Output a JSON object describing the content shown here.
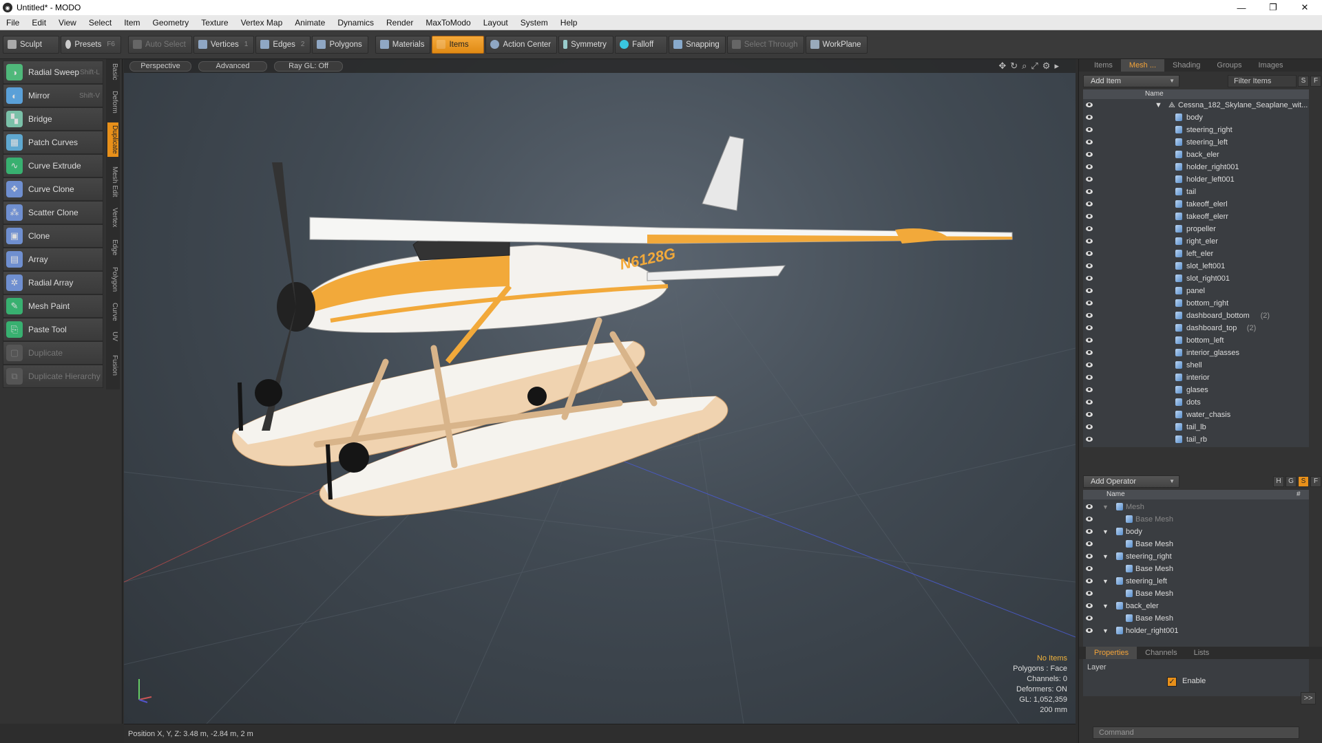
{
  "window": {
    "title": "Untitled* - MODO",
    "minimize": "—",
    "restore": "❐",
    "close": "✕"
  },
  "menu": [
    "File",
    "Edit",
    "View",
    "Select",
    "Item",
    "Geometry",
    "Texture",
    "Vertex Map",
    "Animate",
    "Dynamics",
    "Render",
    "MaxToModo",
    "Layout",
    "System",
    "Help"
  ],
  "toolbar": {
    "sculpt": "Sculpt",
    "presets": "Presets",
    "presets_key": "F6",
    "auto_select": "Auto Select",
    "vertices": "Vertices",
    "vertices_key": "1",
    "edges": "Edges",
    "edges_key": "2",
    "polygons": "Polygons",
    "materials": "Materials",
    "items": "Items",
    "action_center": "Action Center",
    "symmetry": "Symmetry",
    "falloff": "Falloff",
    "snapping": "Snapping",
    "select_through": "Select Through",
    "workplane": "WorkPlane"
  },
  "tools": [
    {
      "label": "Radial Sweep",
      "key": "Shift-L",
      "color": "#4fb87a"
    },
    {
      "label": "Mirror",
      "key": "Shift-V",
      "color": "#5aa0d8"
    },
    {
      "label": "Bridge",
      "key": "",
      "color": "#7ac0a8"
    },
    {
      "label": "Patch Curves",
      "key": "",
      "color": "#5fa8d0"
    },
    {
      "label": "Curve Extrude",
      "key": "",
      "color": "#38b070"
    },
    {
      "label": "Curve Clone",
      "key": "",
      "color": "#6f8fd0"
    },
    {
      "label": "Scatter Clone",
      "key": "",
      "color": "#6f8fd0"
    },
    {
      "label": "Clone",
      "key": "",
      "color": "#6f8fd0"
    },
    {
      "label": "Array",
      "key": "",
      "color": "#6f8fd0"
    },
    {
      "label": "Radial Array",
      "key": "",
      "color": "#6f8fd0"
    },
    {
      "label": "Mesh Paint",
      "key": "",
      "color": "#38b070"
    },
    {
      "label": "Paste Tool",
      "key": "",
      "color": "#38b070"
    },
    {
      "label": "Duplicate",
      "key": "",
      "color": "#666"
    },
    {
      "label": "Duplicate Hierarchy",
      "key": "",
      "color": "#666"
    }
  ],
  "vtabs": [
    "Basic",
    "Deform",
    "Duplicate",
    "Mesh Edit",
    "Vertex",
    "Edge",
    "Polygon",
    "Curve",
    "UV",
    "Fusion"
  ],
  "viewport": {
    "perspective": "Perspective",
    "advanced": "Advanced",
    "raygl": "Ray GL: Off",
    "info": {
      "no_items": "No Items",
      "polygons": "Polygons : Face",
      "channels": "Channels: 0",
      "deformers": "Deformers: ON",
      "gl": "GL: 1,052,359",
      "scale": "200 mm"
    },
    "registration": "N6128G"
  },
  "status": {
    "position": "Position X, Y, Z:  3.48 m, -2.84 m, 2 m"
  },
  "right": {
    "tabs": [
      "Items",
      "Mesh ...",
      "Shading",
      "Groups",
      "Images"
    ],
    "add_item": "Add Item",
    "filter_items": "Filter Items",
    "s_btn": "S",
    "f_btn": "F",
    "name_col": "Name",
    "root": "Cessna_182_Skylane_Seaplane_wit...",
    "items": [
      {
        "label": "body",
        "count": ""
      },
      {
        "label": "steering_right",
        "count": ""
      },
      {
        "label": "steering_left",
        "count": ""
      },
      {
        "label": "back_eler",
        "count": ""
      },
      {
        "label": "holder_right001",
        "count": ""
      },
      {
        "label": "holder_left001",
        "count": ""
      },
      {
        "label": "tail",
        "count": ""
      },
      {
        "label": "takeoff_elerl",
        "count": ""
      },
      {
        "label": "takeoff_elerr",
        "count": ""
      },
      {
        "label": "propeller",
        "count": ""
      },
      {
        "label": "right_eler",
        "count": ""
      },
      {
        "label": "left_eler",
        "count": ""
      },
      {
        "label": "slot_left001",
        "count": ""
      },
      {
        "label": "slot_right001",
        "count": ""
      },
      {
        "label": "panel",
        "count": ""
      },
      {
        "label": "bottom_right",
        "count": ""
      },
      {
        "label": "dashboard_bottom",
        "count": "(2)"
      },
      {
        "label": "dashboard_top",
        "count": "(2)"
      },
      {
        "label": "bottom_left",
        "count": ""
      },
      {
        "label": "interior_glasses",
        "count": ""
      },
      {
        "label": "shell",
        "count": ""
      },
      {
        "label": "interior",
        "count": ""
      },
      {
        "label": "glases",
        "count": ""
      },
      {
        "label": "dots",
        "count": ""
      },
      {
        "label": "water_chasis",
        "count": ""
      },
      {
        "label": "tail_lb",
        "count": ""
      },
      {
        "label": "tail_rb",
        "count": ""
      }
    ],
    "add_operator": "Add Operator",
    "op_h": "H",
    "op_g": "G",
    "op_s": "S",
    "op_f": "F",
    "op_name": "Name",
    "op_hash": "#",
    "operators": [
      {
        "label": "Mesh",
        "indent": 0,
        "dim": true
      },
      {
        "label": "Base Mesh",
        "indent": 1,
        "dim": true
      },
      {
        "label": "body",
        "indent": 0,
        "dim": false
      },
      {
        "label": "Base Mesh",
        "indent": 1,
        "dim": false
      },
      {
        "label": "steering_right",
        "indent": 0,
        "dim": false
      },
      {
        "label": "Base Mesh",
        "indent": 1,
        "dim": false
      },
      {
        "label": "steering_left",
        "indent": 0,
        "dim": false
      },
      {
        "label": "Base Mesh",
        "indent": 1,
        "dim": false
      },
      {
        "label": "back_eler",
        "indent": 0,
        "dim": false
      },
      {
        "label": "Base Mesh",
        "indent": 1,
        "dim": false
      },
      {
        "label": "holder_right001",
        "indent": 0,
        "dim": false
      }
    ],
    "prop_tabs": [
      "Properties",
      "Channels",
      "Lists"
    ],
    "layer": "Layer",
    "enable": "Enable",
    "more": ">>",
    "command": "Command"
  }
}
